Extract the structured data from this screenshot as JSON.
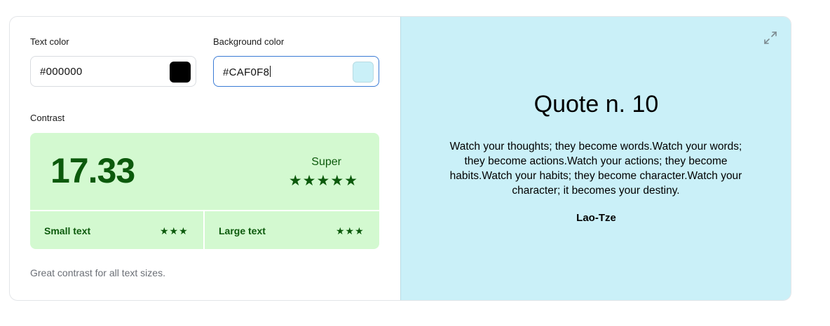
{
  "text_color": {
    "label": "Text color",
    "value": "#000000",
    "swatch": "#000000"
  },
  "background_color": {
    "label": "Background color",
    "value": "#CAF0F8",
    "swatch": "#CAF0F8"
  },
  "contrast": {
    "label": "Contrast",
    "ratio": "17.33",
    "grade": "Super",
    "grade_stars": "★★★★★",
    "small_text": {
      "label": "Small text",
      "stars": "★★★"
    },
    "large_text": {
      "label": "Large text",
      "stars": "★★★"
    },
    "box_color": "#d3f9d0",
    "accent_color": "#0c5a0c"
  },
  "note": "Great contrast for all text sizes.",
  "preview": {
    "expand_icon": "expand-icon",
    "title": "Quote n. 10",
    "text": "Watch your thoughts; they become words.Watch your words; they become actions.Watch your actions; they become habits.Watch your habits; they become character.Watch your character; it becomes your destiny.",
    "author": "Lao-Tze"
  }
}
